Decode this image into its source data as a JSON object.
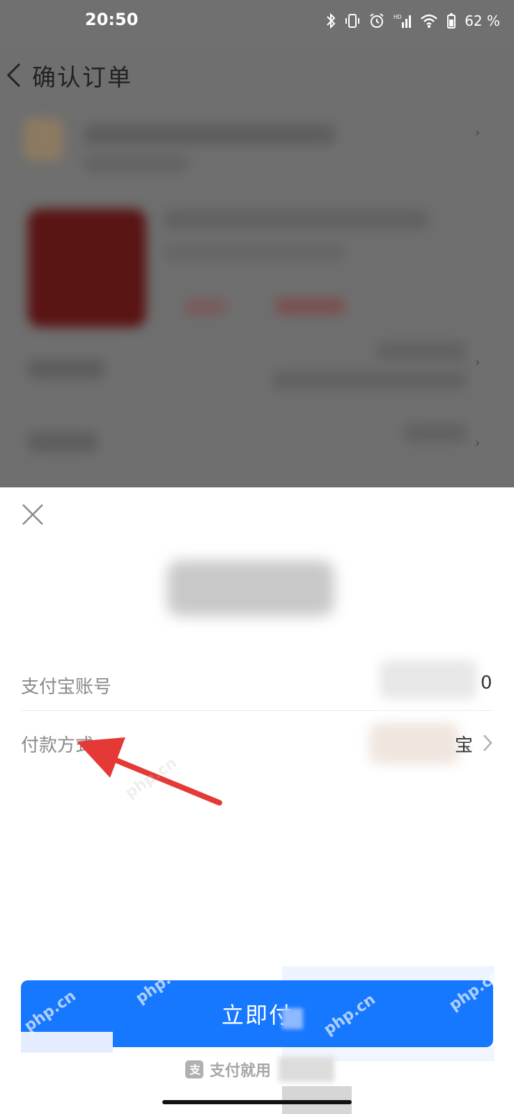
{
  "status_bar": {
    "time": "20:50",
    "battery": "62 %",
    "icons": [
      "bluetooth-icon",
      "vibrate-icon",
      "alarm-icon",
      "signal-hd-icon",
      "wifi-icon",
      "battery-icon"
    ]
  },
  "background_page": {
    "title": "确认订单"
  },
  "sheet": {
    "rows": [
      {
        "label": "支付宝账号",
        "value_tail": "0"
      },
      {
        "label": "付款方式",
        "value_tail": "宝"
      }
    ],
    "pay_button_label": "立即付",
    "footer_label": "支付就用"
  },
  "watermark": {
    "text": "php.cn"
  },
  "colors": {
    "accent": "#1677ff",
    "annotation_arrow": "#e53935",
    "overlay": "#6f6f6f"
  }
}
